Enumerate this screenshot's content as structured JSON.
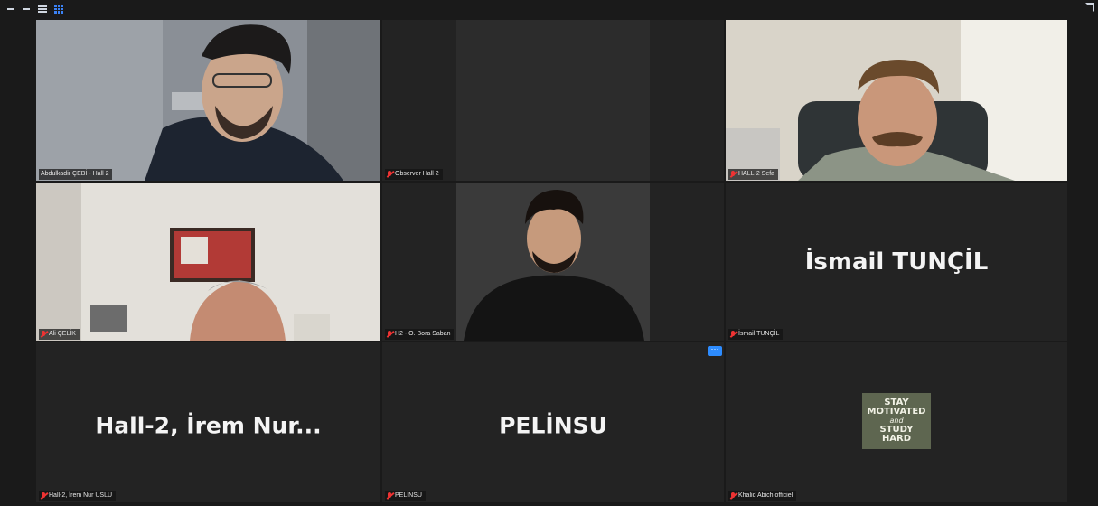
{
  "participants": [
    {
      "name": "Abdulkadir ÇEBİ - Hall 2",
      "video": true,
      "active": true
    },
    {
      "name": "Observer Hall 2",
      "video": false
    },
    {
      "name": "HALL-2 Sefa",
      "video": true
    },
    {
      "name": "Ali ÇELİK",
      "video": true
    },
    {
      "name": "H2 - O. Bora Saban",
      "video": true
    },
    {
      "name": "İsmail TUNÇİL",
      "display_name": "İsmail TUNÇİL",
      "video": false
    },
    {
      "name": "Hall-2, İrem Nur USLU",
      "display_name": "Hall-2, İrem Nur...",
      "video": false
    },
    {
      "name": "PELİNSU",
      "display_name": "PELİNSU",
      "video": false
    },
    {
      "name": "Khalid Abich officiel",
      "video": false,
      "avatar_lines": [
        "STAY",
        "MOTIVATED",
        "and",
        "STUDY",
        "HARD"
      ]
    }
  ],
  "more_button_label": "···",
  "colors": {
    "active_border": "#c8e55a",
    "muted_mic": "#ee3333",
    "accent": "#2d8cff"
  }
}
